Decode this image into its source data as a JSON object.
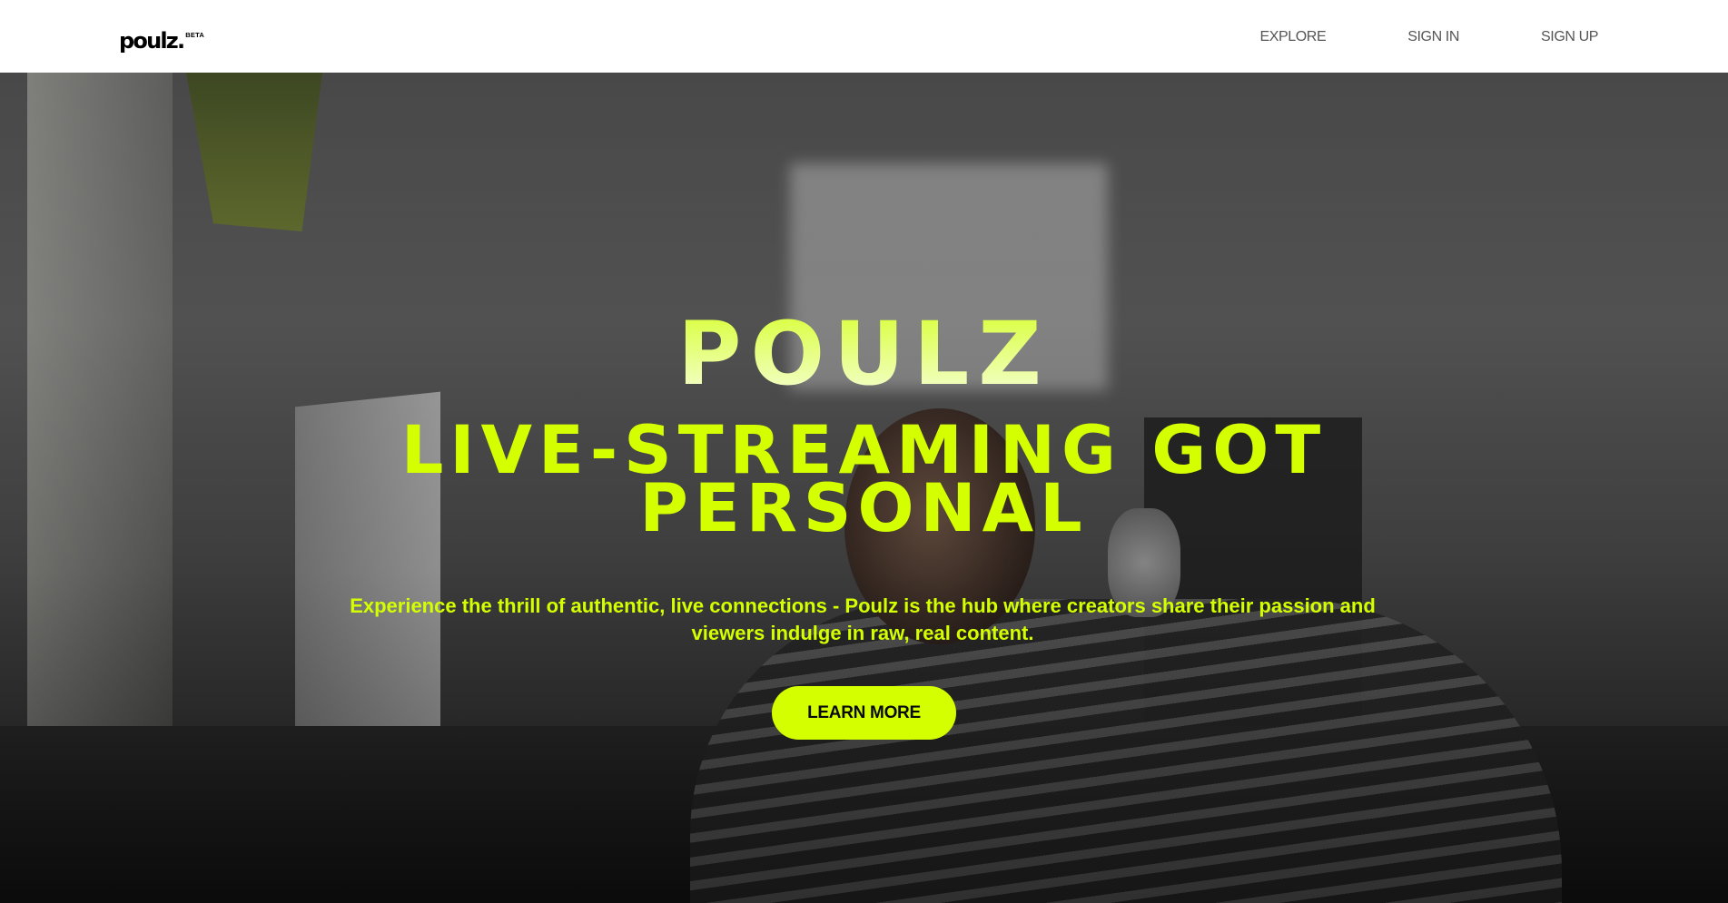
{
  "header": {
    "logo_text": "poulz.",
    "logo_badge": "BETA",
    "nav": {
      "explore": "EXPLORE",
      "sign_in": "SIGN IN",
      "sign_up": "SIGN UP"
    }
  },
  "hero": {
    "brand": "POULZ",
    "tagline_line1": "LIVE-STREAMING GOT",
    "tagline_line2": "PERSONAL",
    "description": "Experience the thrill of authentic, live connections - Poulz is the hub where creators share their passion and viewers indulge in raw, real content.",
    "cta_label": "LEARN MORE"
  },
  "colors": {
    "accent": "#d4ff00",
    "nav_text": "#555555",
    "header_bg": "#ffffff"
  }
}
